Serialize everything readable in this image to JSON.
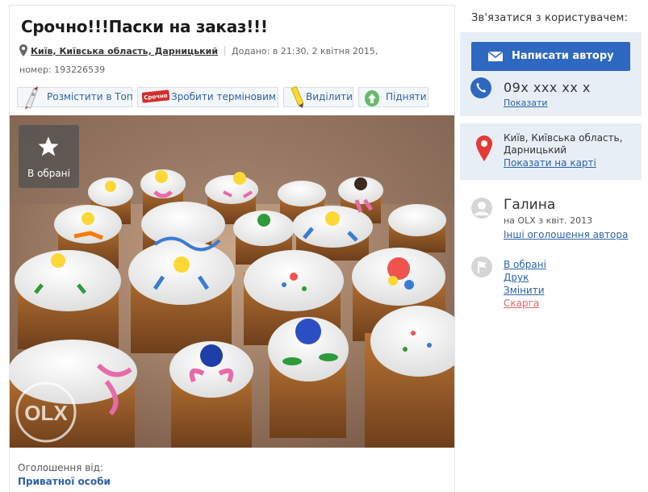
{
  "listing": {
    "title": "Срочно!!!Паски на заказ!!!",
    "location": "Київ, Київська область, Дарницький",
    "added": "Додано: в 21:30, 2 квітня 2015,",
    "number": "номер: 193226539"
  },
  "actions": [
    {
      "label": "Розмістити в Топ",
      "icon": "rocket-icon"
    },
    {
      "label": "Зробити терміновим",
      "icon": "urgent-tag-icon",
      "tag_text": "Срочно"
    },
    {
      "label": "Виділити",
      "icon": "highlighter-icon"
    },
    {
      "label": "Підняти",
      "icon": "raise-arrow-icon"
    }
  ],
  "photo": {
    "favorite_label": "В обрані",
    "watermark": "OLX"
  },
  "seller": {
    "from_label": "Оголошення від:",
    "from_value": "Приватної особи"
  },
  "sidebar": {
    "contact_title": "Зв'язатися з користувачем:",
    "write_button": "Написати автору",
    "phone": "09x xxx xx x",
    "show_phone": "Показати",
    "location": "Київ, Київська область, Дарницький",
    "show_map": "Показати на карті",
    "user_name": "Галина",
    "user_since": "на OLX з квіт. 2013",
    "user_other_ads": "Інші оголошення автора",
    "links": [
      "В обрані",
      "Друк",
      "Змінити",
      "Скарга"
    ]
  },
  "colors": {
    "accent": "#2e68c0",
    "link": "#2d63a8",
    "panel": "#e8eef5",
    "report": "#e06666"
  }
}
